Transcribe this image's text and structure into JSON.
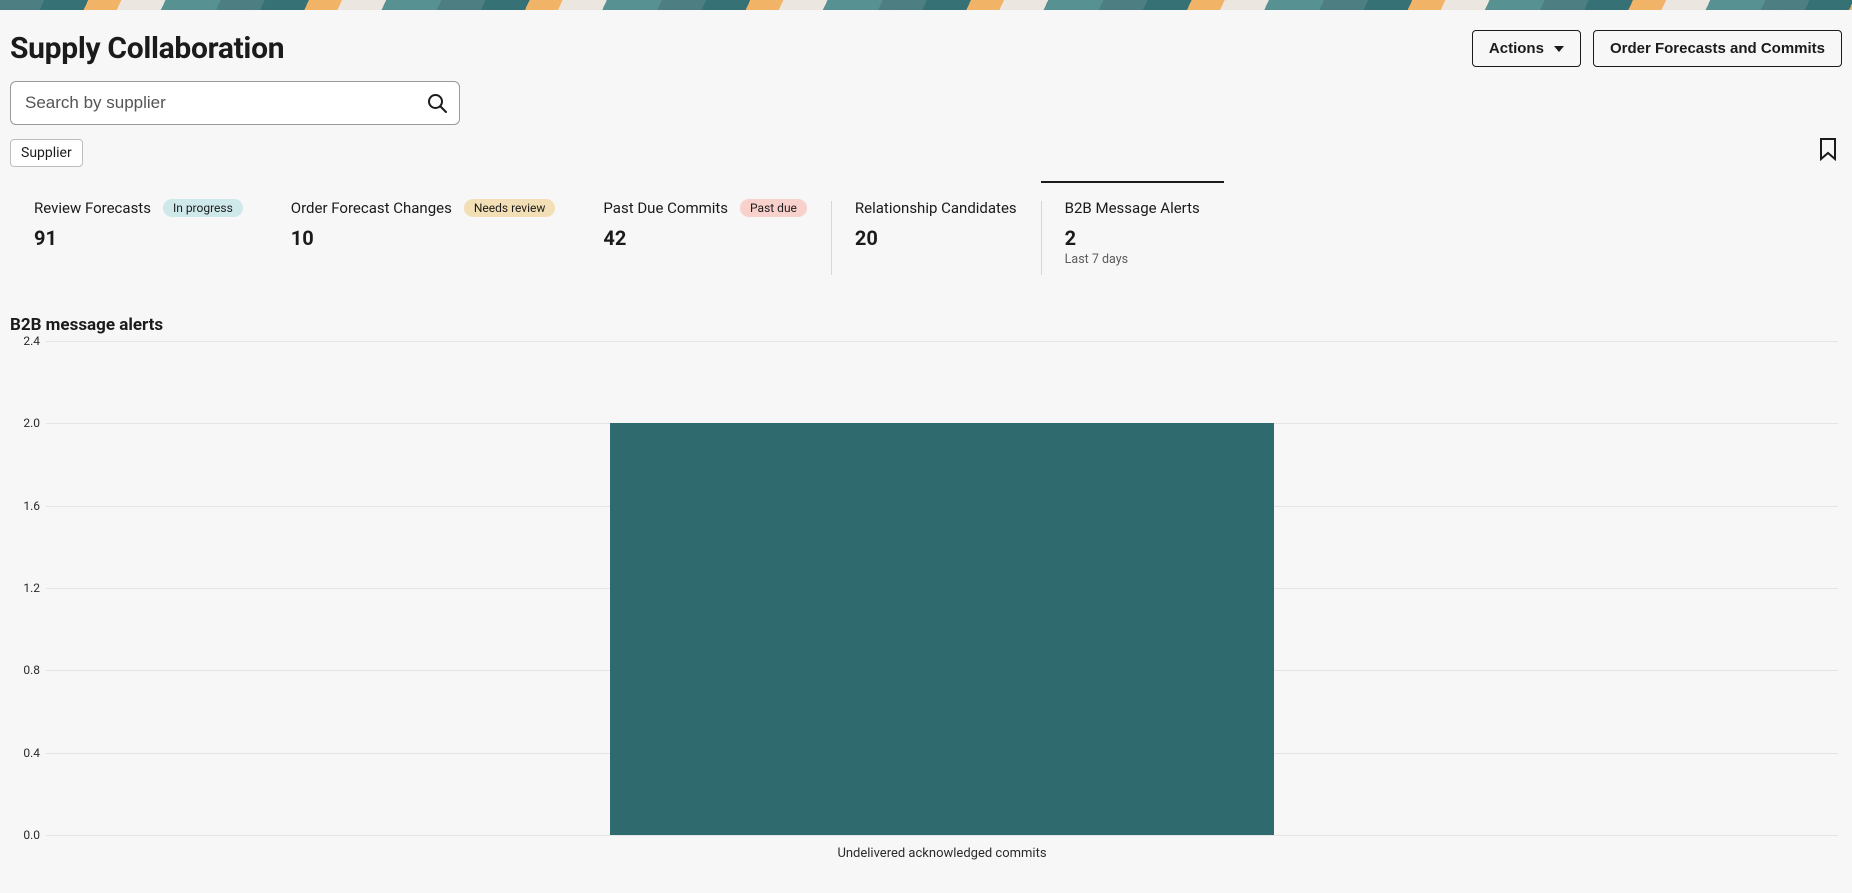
{
  "header": {
    "title": "Supply Collaboration",
    "actions_label": "Actions",
    "ofc_label": "Order Forecasts and Commits"
  },
  "search": {
    "placeholder": "Search by supplier"
  },
  "filter_chip": {
    "label": "Supplier"
  },
  "cards": [
    {
      "label": "Review Forecasts",
      "value": "91",
      "badge": "In progress",
      "badge_kind": "progress",
      "sub": ""
    },
    {
      "label": "Order Forecast Changes",
      "value": "10",
      "badge": "Needs review",
      "badge_kind": "review",
      "sub": ""
    },
    {
      "label": "Past Due Commits",
      "value": "42",
      "badge": "Past due",
      "badge_kind": "pastdue",
      "sub": ""
    },
    {
      "label": "Relationship Candidates",
      "value": "20",
      "badge": "",
      "badge_kind": "",
      "sub": ""
    },
    {
      "label": "B2B Message Alerts",
      "value": "2",
      "badge": "",
      "badge_kind": "",
      "sub": "Last 7 days"
    }
  ],
  "active_card_index": 4,
  "section_title": "B2B message alerts",
  "chart_data": {
    "type": "bar",
    "categories": [
      "Undelivered acknowledged commits"
    ],
    "values": [
      2.0
    ],
    "title": "B2B message alerts",
    "xlabel": "",
    "ylabel": "",
    "ylim": [
      0.0,
      2.4
    ],
    "yticks": [
      0.0,
      0.4,
      0.8,
      1.2,
      1.6,
      2.0,
      2.4
    ],
    "bar_color": "#2f6a6e"
  }
}
